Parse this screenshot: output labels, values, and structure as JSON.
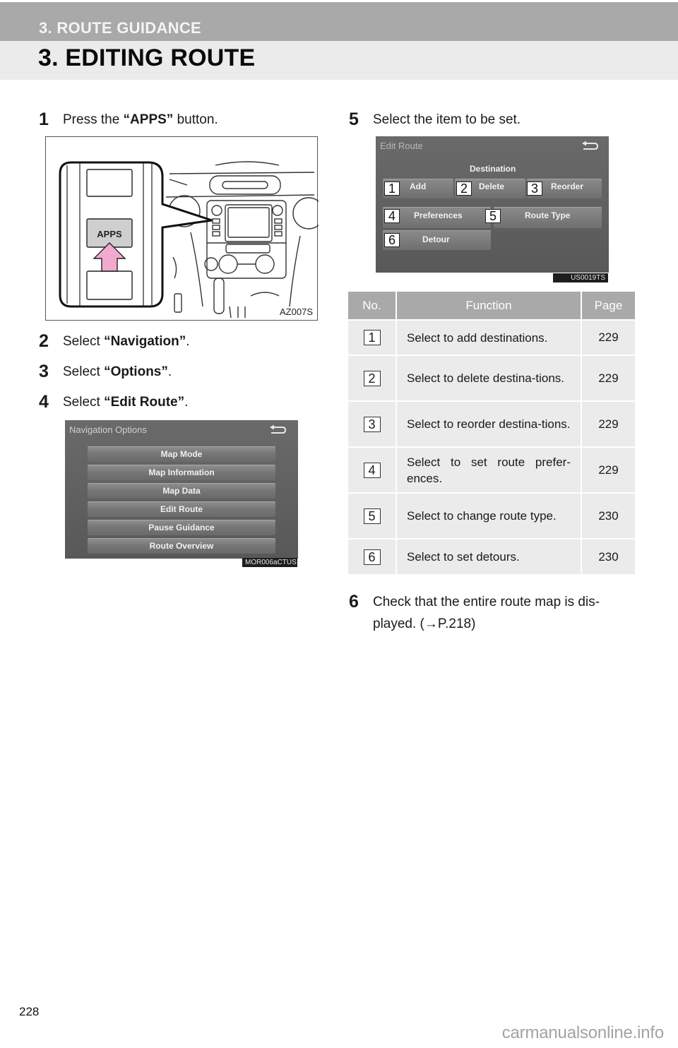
{
  "header": {
    "section": "3. ROUTE GUIDANCE",
    "title": "3. EDITING ROUTE"
  },
  "steps": [
    {
      "num": "1",
      "prefix": "Press the ",
      "bold": "“APPS”",
      "suffix": " button."
    },
    {
      "num": "2",
      "prefix": "Select ",
      "bold": "“Navigation”",
      "suffix": "."
    },
    {
      "num": "3",
      "prefix": "Select ",
      "bold": "“Options”",
      "suffix": "."
    },
    {
      "num": "4",
      "prefix": "Select ",
      "bold": "“Edit Route”",
      "suffix": "."
    },
    {
      "num": "5",
      "prefix": "Select the item to be set.",
      "bold": "",
      "suffix": ""
    },
    {
      "num": "6",
      "line1": "Check that the entire route map is dis-",
      "line2": "played. (→P.218)"
    }
  ],
  "figure_apps": {
    "button_label": "APPS",
    "code": "AZ007S",
    "arrow_color": "#f2a9cf"
  },
  "nav_options_screen": {
    "title": "Navigation Options",
    "back_icon": "back-arrow-icon",
    "items": [
      "Map Mode",
      "Map Information",
      "Map Data",
      "Edit Route",
      "Pause Guidance",
      "Route Overview"
    ],
    "code": "MOR006aCTUS"
  },
  "edit_route_screen": {
    "title": "Edit Route",
    "back_icon": "back-arrow-icon",
    "group_label": "Destination",
    "buttons": [
      {
        "num": "1",
        "label": "Add"
      },
      {
        "num": "2",
        "label": "Delete"
      },
      {
        "num": "3",
        "label": "Reorder"
      },
      {
        "num": "4",
        "label": "Preferences"
      },
      {
        "num": "5",
        "label": "Route Type"
      },
      {
        "num": "6",
        "label": "Detour"
      }
    ],
    "code": "US0019TS"
  },
  "table": {
    "headers": [
      "No.",
      "Function",
      "Page"
    ],
    "rows": [
      {
        "no": "1",
        "function": "Select to add destinations.",
        "page": "229"
      },
      {
        "no": "2",
        "function": "Select to delete destina-tions.",
        "page": "229"
      },
      {
        "no": "3",
        "function": "Select to reorder destina-tions.",
        "page": "229"
      },
      {
        "no": "4",
        "function": "Select to set route prefer-ences.",
        "page": "229"
      },
      {
        "no": "5",
        "function": "Select to change route type.",
        "page": "230"
      },
      {
        "no": "6",
        "function": "Select to set detours.",
        "page": "230"
      }
    ]
  },
  "footer": {
    "page_number": "228",
    "watermark": "carmanualsonline.info"
  }
}
